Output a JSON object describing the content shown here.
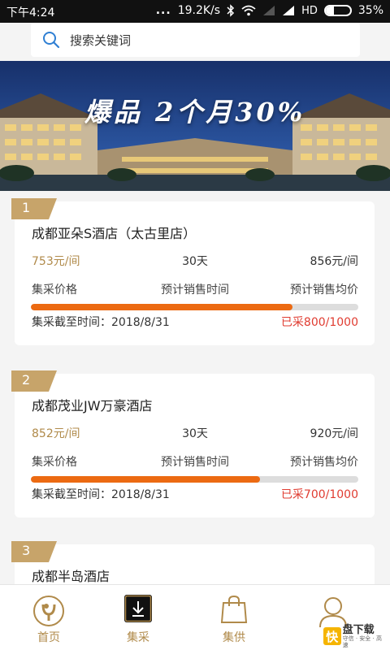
{
  "status_bar": {
    "time": "下午4:24",
    "dots": "...",
    "speed": "19.2K/s",
    "network": "HD",
    "battery": "35%",
    "battery_level": 0.35
  },
  "search": {
    "placeholder": "搜索关键词"
  },
  "banner": {
    "text": "爆品  2个月30%"
  },
  "cards": [
    {
      "index": "1",
      "title": "成都亚朵S酒店（太古里店）",
      "price": "753元/间",
      "days": "30天",
      "avg_price": "856元/间",
      "price_label": "集采价格",
      "days_label": "预计销售时间",
      "avg_label": "预计销售均价",
      "deadline": "集采截至时间：2018/8/31",
      "progress_text": "已采800/1000",
      "progress": 0.8
    },
    {
      "index": "2",
      "title": "成都茂业JW万豪酒店",
      "price": "852元/间",
      "days": "30天",
      "avg_price": "920元/间",
      "price_label": "集采价格",
      "days_label": "预计销售时间",
      "avg_label": "预计销售均价",
      "deadline": "集采截至时间：2018/8/31",
      "progress_text": "已采700/1000",
      "progress": 0.7
    },
    {
      "index": "3",
      "title": "成都半岛酒店"
    }
  ],
  "tabs": [
    {
      "label": "首页",
      "icon": "home-logo-icon"
    },
    {
      "label": "集采",
      "icon": "download-icon"
    },
    {
      "label": "集供",
      "icon": "shopping-bag-icon"
    },
    {
      "label": "",
      "icon": "user-icon"
    }
  ],
  "watermark": {
    "badge": "快",
    "title": "盘下载",
    "sub": "守信 · 安全 · 高速"
  },
  "colors": {
    "accent": "#b08a4a",
    "progress": "#ec6a12",
    "alert": "#e03c31"
  }
}
